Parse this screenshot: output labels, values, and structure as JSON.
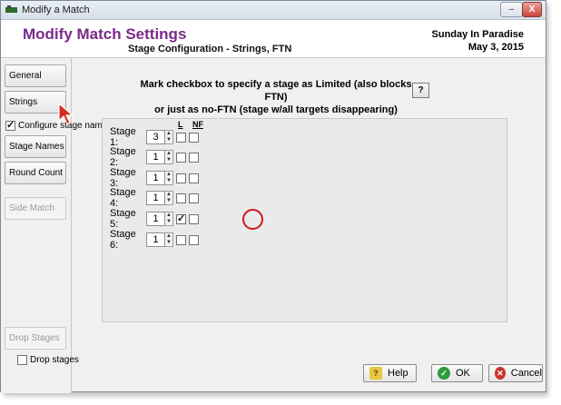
{
  "window": {
    "title": "Modify a Match",
    "minimize_label": "–",
    "close_label": "X"
  },
  "header": {
    "title": "Modify Match Settings",
    "subtitle": "Stage Configuration - Strings, FTN",
    "match_name": "Sunday In Paradise",
    "match_date": "May  3, 2015"
  },
  "sidebar": {
    "general": "General",
    "strings": "Strings",
    "configure_stages": "Configure stage names",
    "stage_names": "Stage Names",
    "round_count": "Round Count",
    "side_match": "Side Match",
    "drop_stages_button": "Drop Stages",
    "drop_stages_check": "Drop stages"
  },
  "main": {
    "instruction_line1": "Mark checkbox to specify a stage as Limited (also blocks FTN)",
    "instruction_line2": "or just as no-FTN (stage w/all targets disappearing)",
    "help_q": "?",
    "col_limited": "L",
    "col_noftn": "NF",
    "stages": [
      {
        "label": "Stage 1:",
        "strings": "3",
        "limited": false,
        "noftn": false
      },
      {
        "label": "Stage 2:",
        "strings": "1",
        "limited": false,
        "noftn": false
      },
      {
        "label": "Stage 3:",
        "strings": "1",
        "limited": false,
        "noftn": false
      },
      {
        "label": "Stage 4:",
        "strings": "1",
        "limited": false,
        "noftn": false
      },
      {
        "label": "Stage 5:",
        "strings": "1",
        "limited": true,
        "noftn": false
      },
      {
        "label": "Stage 6:",
        "strings": "1",
        "limited": false,
        "noftn": false
      }
    ]
  },
  "footer": {
    "help": "Help",
    "ok": "OK",
    "cancel": "Cancel"
  },
  "colors": {
    "title_purple": "#7a2a8a",
    "highlight_red": "#d01818",
    "ok_green": "#2e9a3a",
    "cancel_red": "#c8342b"
  }
}
